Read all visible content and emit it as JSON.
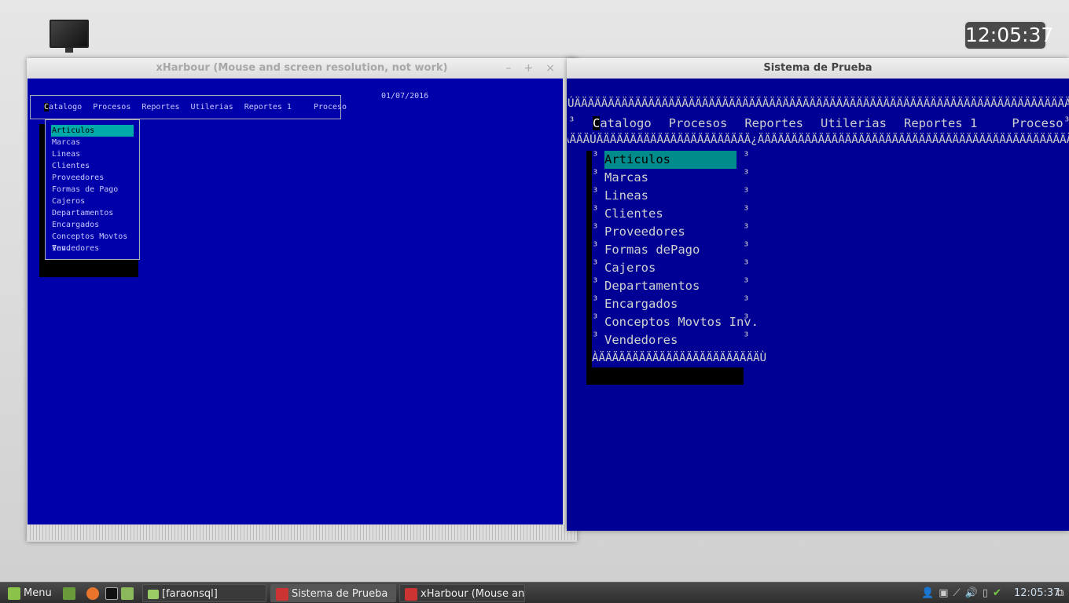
{
  "desktop": {
    "clock": "12:05:37"
  },
  "xharbour": {
    "title": "xHarbour (Mouse and screen resolution, not work)",
    "controls": [
      "–",
      "+",
      "×"
    ],
    "date": "01/07/2016",
    "menu": [
      "Catalogo",
      "Procesos",
      "Reportes",
      "Utilerias",
      "Reportes 1",
      "Proceso"
    ],
    "dropdown": [
      "Articulos",
      "Marcas",
      "Lineas",
      "Clientes",
      "Proveedores",
      "Formas de Pago",
      "Cajeros",
      "Departamentos",
      "Encargados",
      "Conceptos Movtos Inv.",
      "Vendedores"
    ]
  },
  "sistema": {
    "title": "Sistema de Prueba",
    "border_top": "ÚÄÄÄÄÄÄÄÄÄÄÄÄÄÄÄÄÄÄÄÄÄÄÄÄÄÄÄÄÄÄÄÄÄÄÄÄÄÄÄÄÄÄÄÄÄÄÄÄÄÄÄÄÄÄÄÄÄÄÄÄÄÄÄÄÄÄÄÄÄÄÄÄÄÄÄÄÄÄÄÄÄ¿",
    "border_mid": "ÀÄÄÄÚÄÄÄÄÄÄÄÄÄÄÄÄÄÄÄÄÄÄÄÄÄÄÄ¿ÄÄÄÄÄÄÄÄÄÄÄÄÄÄÄÄÄÄÄÄÄÄÄÄÄÄÄÄÄÄÄÄÄÄÄÄÄÄÄÄÄÄÄÄÄÄÄÄÄÄÄÙ",
    "border_bottom": "ÀÄÄÄÄÄÄÄÄÄÄÄÄÄÄÄÄÄÄÄÄÄÄÄÄÙ",
    "side_char": "³",
    "menu": [
      "Catalogo",
      "Procesos",
      "Reportes",
      "Utilerias",
      "Reportes 1",
      "Proceso"
    ],
    "dropdown": [
      "Articulos",
      "Marcas",
      "Lineas",
      "Clientes",
      "Proveedores",
      "Formas dePago",
      "Cajeros",
      "Departamentos",
      "Encargados",
      "Conceptos Movtos Inv.",
      "Vendedores"
    ]
  },
  "taskbar": {
    "menu_label": "Menu",
    "items": [
      "[faraonsql]",
      "Sistema de Prueba",
      "xHarbour (Mouse an..."
    ],
    "clock": "12:05:37"
  }
}
